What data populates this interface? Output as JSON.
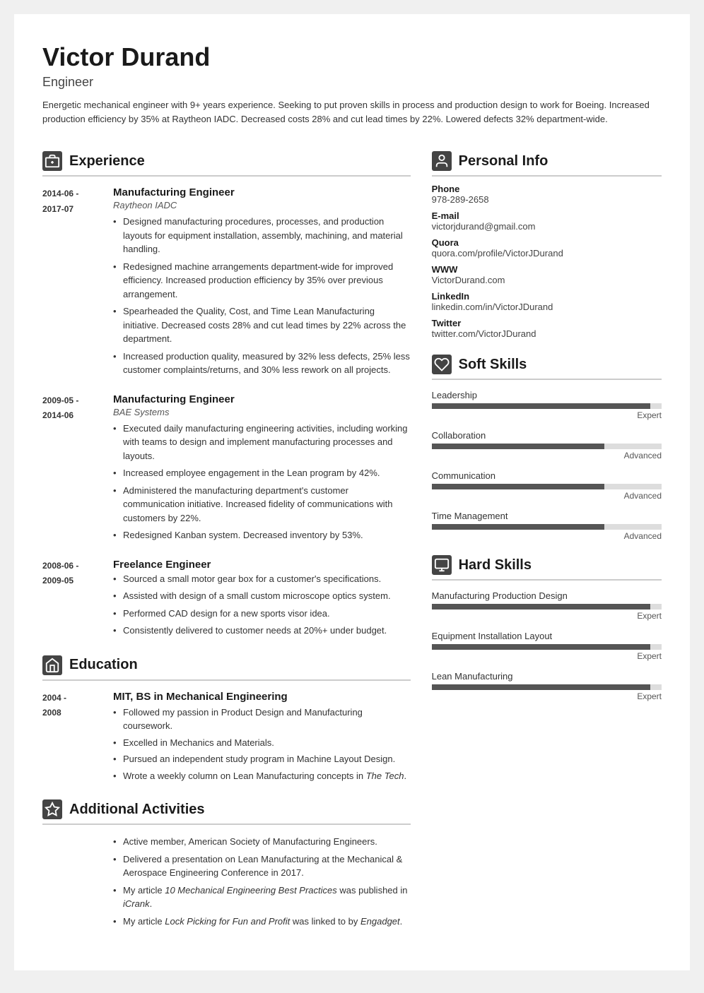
{
  "header": {
    "name": "Victor Durand",
    "title": "Engineer",
    "summary": "Energetic mechanical engineer with 9+ years experience. Seeking to put proven skills in process and production design to work for Boeing. Increased production efficiency by 35% at Raytheon IADC. Decreased costs 28% and cut lead times by 22%. Lowered defects 32% department-wide."
  },
  "experience": {
    "section_title": "Experience",
    "entries": [
      {
        "date_start": "2014-06 -",
        "date_end": "2017-07",
        "job_title": "Manufacturing Engineer",
        "company": "Raytheon IADC",
        "bullets": [
          "Designed manufacturing procedures, processes, and production layouts for equipment installation, assembly, machining, and material handling.",
          "Redesigned machine arrangements department-wide for improved efficiency. Increased production efficiency by 35% over previous arrangement.",
          "Spearheaded the Quality, Cost, and Time Lean Manufacturing initiative. Decreased costs 28% and cut lead times by 22% across the department.",
          "Increased production quality, measured by 32% less defects, 25% less customer complaints/returns, and 30% less rework on all projects."
        ]
      },
      {
        "date_start": "2009-05 -",
        "date_end": "2014-06",
        "job_title": "Manufacturing Engineer",
        "company": "BAE Systems",
        "bullets": [
          "Executed daily manufacturing engineering activities, including working with teams to design and implement manufacturing processes and layouts.",
          "Increased employee engagement in the Lean program by 42%.",
          "Administered the manufacturing department's customer communication initiative. Increased fidelity of communications with customers by 22%.",
          "Redesigned Kanban system. Decreased inventory by 53%."
        ]
      },
      {
        "date_start": "2008-06 -",
        "date_end": "2009-05",
        "job_title": "Freelance Engineer",
        "company": "",
        "bullets": [
          "Sourced a small motor gear box for a customer's specifications.",
          "Assisted with design of a small custom microscope optics system.",
          "Performed CAD design for a new sports visor idea.",
          "Consistently delivered to customer needs at 20%+ under budget."
        ]
      }
    ]
  },
  "education": {
    "section_title": "Education",
    "entries": [
      {
        "date_start": "2004 -",
        "date_end": "2008",
        "school": "MIT, BS in Mechanical Engineering",
        "bullets": [
          "Followed my passion in Product Design and Manufacturing coursework.",
          "Excelled in Mechanics and Materials.",
          "Pursued an independent study program in Machine Layout Design.",
          "Wrote a weekly column on Lean Manufacturing concepts in The Tech."
        ]
      }
    ]
  },
  "additional": {
    "section_title": "Additional Activities",
    "bullets": [
      "Active member, American Society of Manufacturing Engineers.",
      "Delivered a presentation on Lean Manufacturing at the Mechanical & Aerospace Engineering Conference in 2017.",
      "My article 10 Mechanical Engineering Best Practices was published in iCrank.",
      "My article Lock Picking for Fun and Profit was linked to by Engadget."
    ]
  },
  "personal_info": {
    "section_title": "Personal Info",
    "fields": [
      {
        "label": "Phone",
        "value": "978-289-2658"
      },
      {
        "label": "E-mail",
        "value": "victorjdurand@gmail.com"
      },
      {
        "label": "Quora",
        "value": "quora.com/profile/VictorJDurand"
      },
      {
        "label": "WWW",
        "value": "VictorDurand.com"
      },
      {
        "label": "LinkedIn",
        "value": "linkedin.com/in/VictorJDurand"
      },
      {
        "label": "Twitter",
        "value": "twitter.com/VictorJDurand"
      }
    ]
  },
  "soft_skills": {
    "section_title": "Soft Skills",
    "skills": [
      {
        "name": "Leadership",
        "level": "Expert",
        "pct": 95
      },
      {
        "name": "Collaboration",
        "level": "Advanced",
        "pct": 75
      },
      {
        "name": "Communication",
        "level": "Advanced",
        "pct": 75
      },
      {
        "name": "Time Management",
        "level": "Advanced",
        "pct": 75
      }
    ]
  },
  "hard_skills": {
    "section_title": "Hard Skills",
    "skills": [
      {
        "name": "Manufacturing Production Design",
        "level": "Expert",
        "pct": 95
      },
      {
        "name": "Equipment Installation Layout",
        "level": "Expert",
        "pct": 95
      },
      {
        "name": "Lean Manufacturing",
        "level": "Expert",
        "pct": 95
      }
    ]
  }
}
